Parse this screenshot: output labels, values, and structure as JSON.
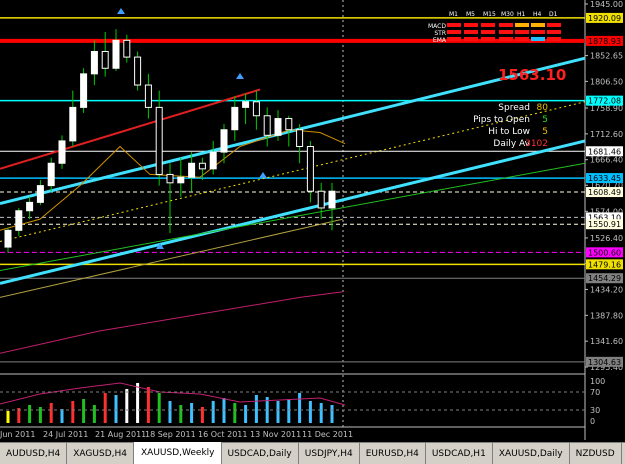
{
  "price_axis": {
    "labels": [
      "1945.00",
      "1852.65",
      "1806.50",
      "1758.90",
      "1712.60",
      "1666.40",
      "1620.70",
      "1574.00",
      "1526.40",
      "1480.40",
      "1434.20",
      "1387.80",
      "1341.60",
      "1295.40"
    ],
    "tags": [
      {
        "text": "1920.09",
        "bg": "#f0e000",
        "fg": "#000"
      },
      {
        "text": "1878.93",
        "bg": "#ff0000",
        "fg": "#000"
      },
      {
        "text": "1772.08",
        "bg": "#00ffff",
        "fg": "#000"
      },
      {
        "text": "1681.46",
        "bg": "#ffffff",
        "fg": "#000"
      },
      {
        "text": "1633.45",
        "bg": "#00bfff",
        "fg": "#000"
      },
      {
        "text": "1608.49",
        "bg": "#ffffe0",
        "fg": "#000"
      },
      {
        "text": "1563.10",
        "bg": "#ffffff",
        "fg": "#000"
      },
      {
        "text": "1550.91",
        "bg": "#ffffe0",
        "fg": "#000"
      },
      {
        "text": "1500.60",
        "bg": "#ff00ff",
        "fg": "#000"
      },
      {
        "text": "1479.16",
        "bg": "#f0e000",
        "fg": "#000"
      },
      {
        "text": "1454.29",
        "bg": "#808080",
        "fg": "#000"
      },
      {
        "text": "1304.63",
        "bg": "#808080",
        "fg": "#000"
      }
    ]
  },
  "indicator_axis": {
    "labels": [
      "100",
      "70",
      "30",
      "0"
    ]
  },
  "time_axis": {
    "labels": [
      "Jun 2011",
      "24 Jul 2011",
      "21 Aug 2011",
      "18 Sep 2011",
      "16 Oct 2011",
      "13 Nov 2011",
      "11 Dec 2011"
    ]
  },
  "signal_panel": {
    "timeframes": [
      "M1",
      "M5",
      "M15",
      "M30",
      "H1",
      "H4",
      "D1"
    ],
    "rows": [
      "MACD",
      "STR",
      "EMA"
    ],
    "price": "1563.10",
    "price_color": "#ff2020",
    "stats": [
      {
        "label": "Spread",
        "value": "80"
      },
      {
        "label": "Pips to Open",
        "value": "5"
      },
      {
        "label": "Hi to Low",
        "value": "5"
      },
      {
        "label": "Daily Av",
        "value": "3102"
      }
    ]
  },
  "tabs": [
    {
      "label": "AUDUSD,H4",
      "active": false
    },
    {
      "label": "XAGUSD,H4",
      "active": false
    },
    {
      "label": "XAUUSD,Weekly",
      "active": true
    },
    {
      "label": "USDCAD,Daily",
      "active": false
    },
    {
      "label": "USDJPY,H4",
      "active": false
    },
    {
      "label": "EURUSD,H4",
      "active": false
    },
    {
      "label": "USDCAD,H1",
      "active": false
    },
    {
      "label": "XAUUSD,Daily",
      "active": false
    },
    {
      "label": "NZDUSD",
      "active": false
    }
  ],
  "colors": {
    "up": "#ffffff",
    "down": "#ffffff",
    "wick": "#00cc00",
    "grid": "#404040"
  }
}
